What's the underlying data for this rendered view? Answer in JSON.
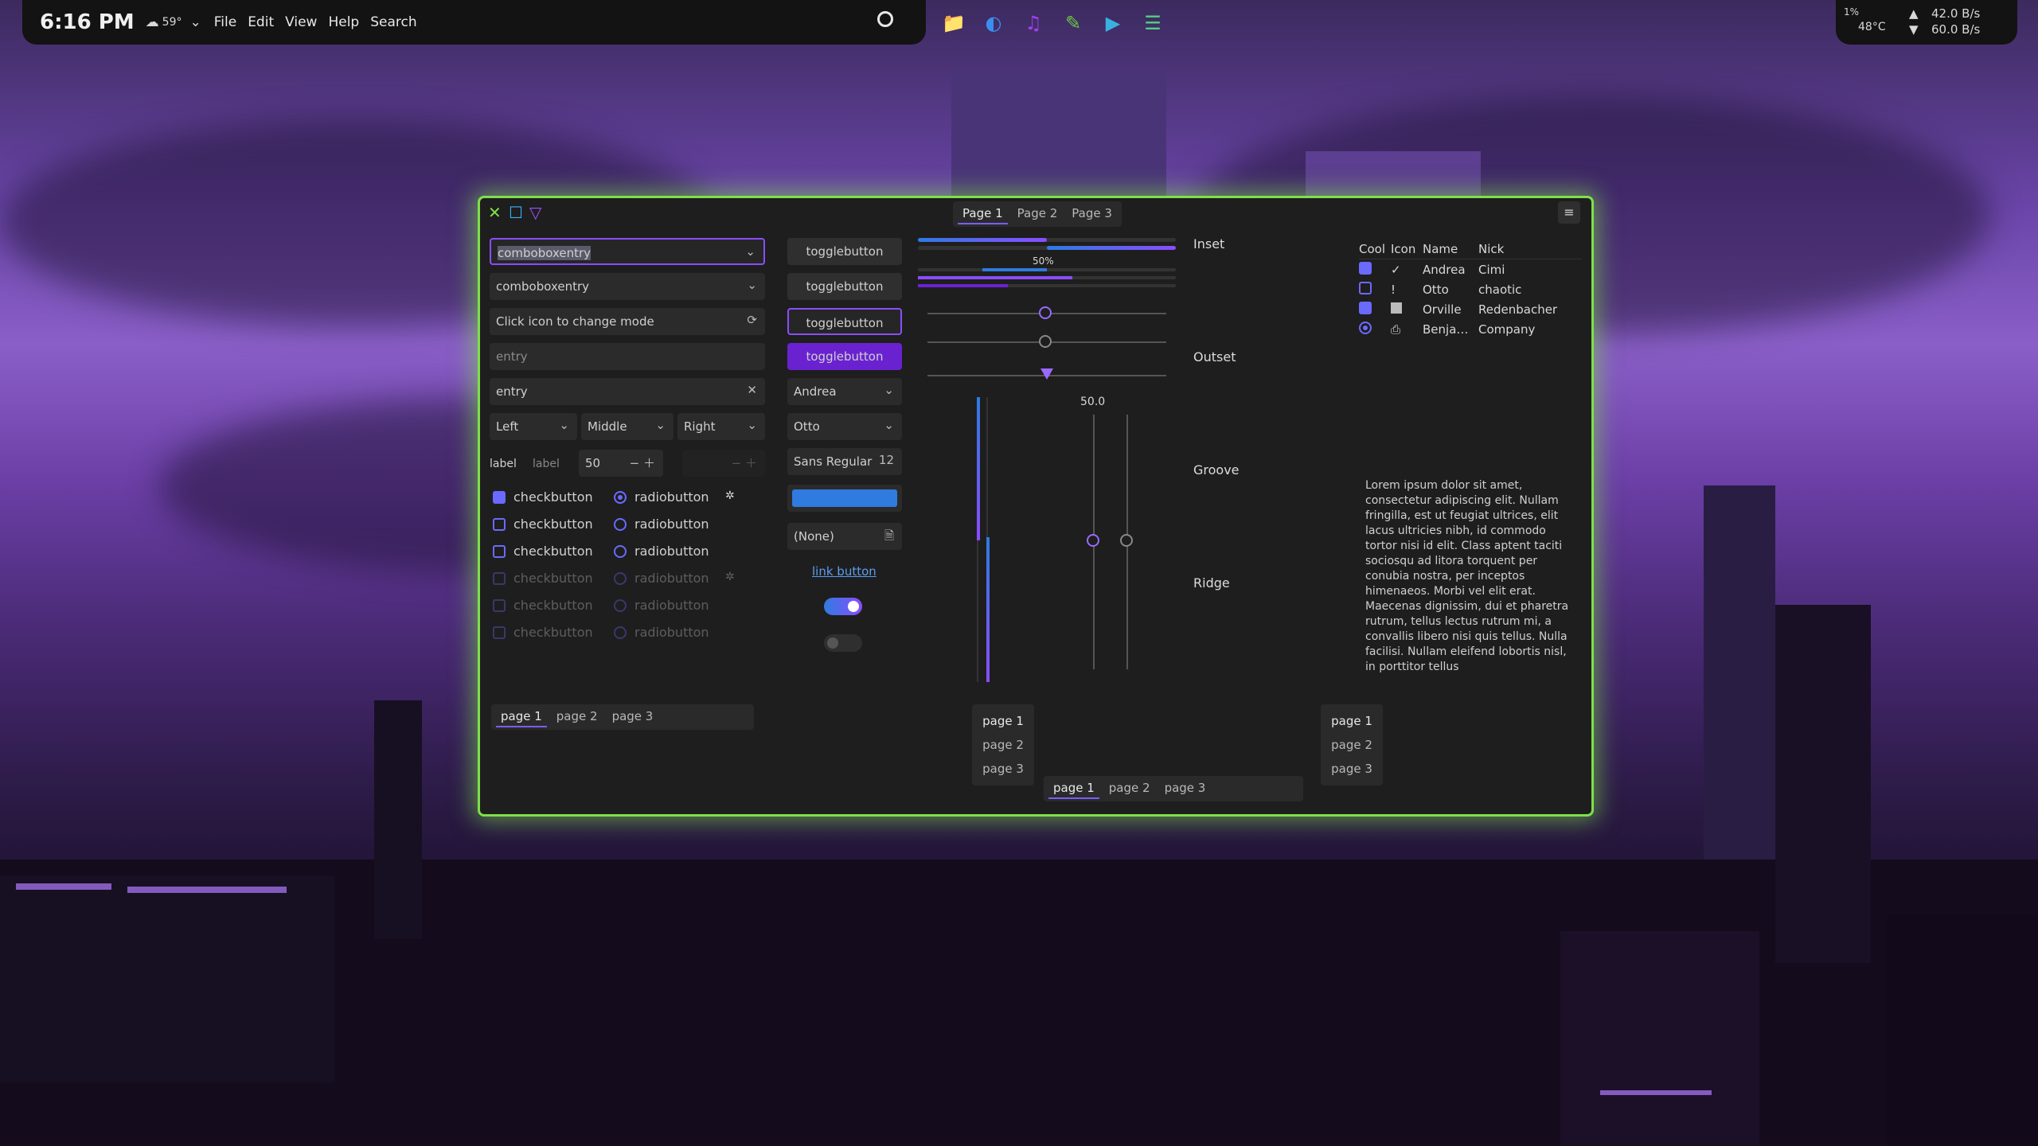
{
  "panel": {
    "clock": "6:16 PM",
    "weather": "59°",
    "menu": [
      "File",
      "Edit",
      "View",
      "Help",
      "Search"
    ],
    "stats": {
      "percent": "1%",
      "temp": "48°C",
      "up": "42.0 B/s",
      "down": "60.0 B/s"
    }
  },
  "window": {
    "header_tabs": [
      "Page 1",
      "Page 2",
      "Page 3"
    ],
    "entries": {
      "combo1": "comboboxentry",
      "combo2": "comboboxentry",
      "mode": "Click icon to change mode",
      "entry1": "entry",
      "entry2": "entry"
    },
    "combos": [
      "Left",
      "Middle",
      "Right"
    ],
    "labels": [
      "label",
      "label"
    ],
    "spin_value": "50",
    "checkbuttons": [
      "checkbutton",
      "checkbutton",
      "checkbutton",
      "checkbutton",
      "checkbutton",
      "checkbutton"
    ],
    "radiobuttons": [
      "radiobutton",
      "radiobutton",
      "radiobutton",
      "radiobutton",
      "radiobutton",
      "radiobutton"
    ],
    "togglebuttons": [
      "togglebutton",
      "togglebutton",
      "togglebutton",
      "togglebutton"
    ],
    "combo_andrea": "Andrea",
    "combo_otto": "Otto",
    "font_button": "Sans Regular",
    "font_size": "12",
    "file_button": "(None)",
    "link": "link button",
    "progress_label": "50%",
    "scale_value": "50.0",
    "frames": [
      "Inset",
      "Outset",
      "Groove",
      "Ridge"
    ],
    "tree": {
      "headers": [
        "Cool",
        "Icon",
        "Name",
        "Nick"
      ],
      "rows": [
        {
          "name": "Andrea",
          "nick": "Cimi",
          "icon": "✓"
        },
        {
          "name": "Otto",
          "nick": "chaotic",
          "icon": "!"
        },
        {
          "name": "Orville",
          "nick": "Redenbacher",
          "icon": ""
        },
        {
          "name": "Benja…",
          "nick": "Company",
          "icon": ""
        }
      ]
    },
    "lorem": "Lorem ipsum dolor sit amet, consectetur adipiscing elit. Nullam fringilla, est ut feugiat ultrices, elit lacus ultricies nibh, id commodo tortor nisi id elit. Class aptent taciti sociosqu ad litora torquent per conubia nostra, per inceptos himenaeos. Morbi vel elit erat. Maecenas dignissim, dui et pharetra rutrum, tellus lectus rutrum mi, a convallis libero nisi quis tellus. Nulla facilisi. Nullam eleifend lobortis nisl, in porttitor tellus",
    "bottom_tabs": [
      "page 1",
      "page 2",
      "page 3"
    ],
    "progress": {
      "bar1": 0.5,
      "bar2": 0.5,
      "bar3": 0.25,
      "bar4": 0.6,
      "bar5": 0.35
    },
    "colors": {
      "accent": "#8a4dff",
      "blue": "#2f7be0",
      "border": "#7fe04a"
    }
  }
}
